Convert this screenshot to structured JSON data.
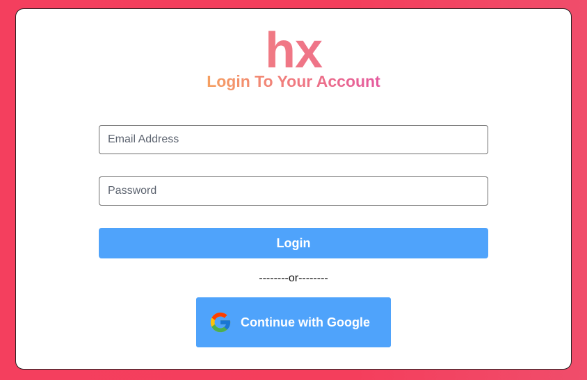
{
  "brand": {
    "logo_text": "hx",
    "gradient_start": "#f59e6b",
    "gradient_end": "#e9559b"
  },
  "form": {
    "title": "Login To Your Account",
    "email": {
      "placeholder": "Email Address",
      "value": ""
    },
    "password": {
      "placeholder": "Password",
      "value": ""
    },
    "login_label": "Login",
    "divider_text": "--------or--------",
    "google_label": "Continue with Google",
    "google_icon": "google-icon"
  },
  "colors": {
    "background": "#f43f5e",
    "button": "#4fa3fb",
    "card": "#ffffff"
  }
}
